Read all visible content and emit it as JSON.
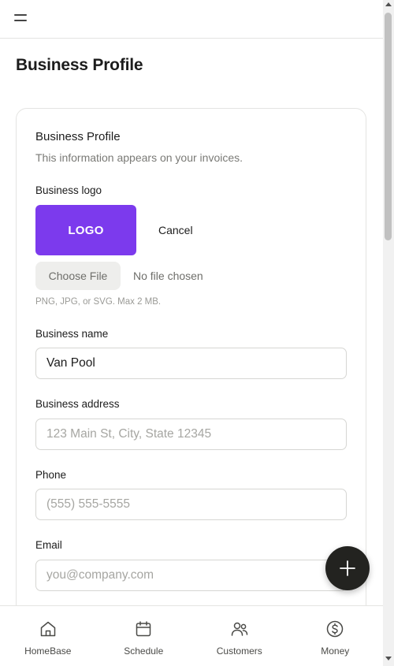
{
  "header": {
    "menu_icon": "hamburger-menu-icon"
  },
  "page": {
    "title": "Business Profile"
  },
  "card": {
    "title": "Business Profile",
    "subtitle": "This information appears on your invoices."
  },
  "logo": {
    "label": "Business logo",
    "preview_text": "LOGO",
    "preview_color": "#7c3aed",
    "cancel_label": "Cancel",
    "choose_file_label": "Choose File",
    "file_status": "No file chosen",
    "hint": "PNG, JPG, or SVG. Max 2 MB."
  },
  "fields": {
    "business_name": {
      "label": "Business name",
      "value": "Van Pool",
      "placeholder": ""
    },
    "business_address": {
      "label": "Business address",
      "value": "",
      "placeholder": "123 Main St, City, State 12345"
    },
    "phone": {
      "label": "Phone",
      "value": "",
      "placeholder": "(555) 555-5555"
    },
    "email": {
      "label": "Email",
      "value": "",
      "placeholder": "you@company.com"
    }
  },
  "fab": {
    "icon": "plus-icon"
  },
  "bottom_nav": {
    "items": [
      {
        "label": "HomeBase",
        "icon": "home-icon"
      },
      {
        "label": "Schedule",
        "icon": "calendar-icon"
      },
      {
        "label": "Customers",
        "icon": "users-icon"
      },
      {
        "label": "Money",
        "icon": "dollar-circle-icon"
      }
    ]
  }
}
